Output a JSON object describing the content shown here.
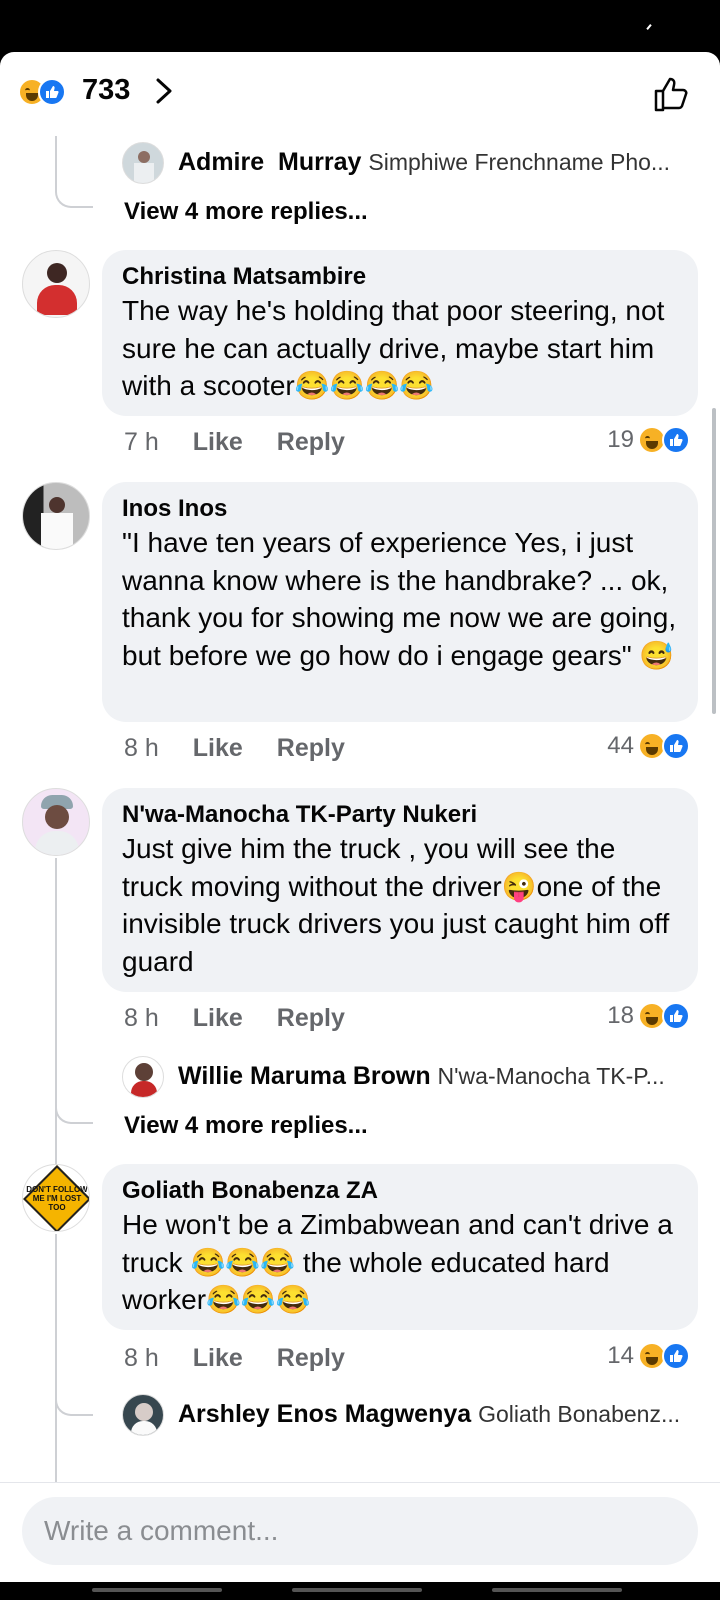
{
  "header": {
    "reaction_total": "733"
  },
  "comments": [
    {
      "author": "Christina Matsambire",
      "text": "The way he's holding that poor steering, not sure he can actually drive, maybe start him with a scooter",
      "emoji_suffix": "😂😂😂😂",
      "time": "7 h",
      "like": "Like",
      "reply": "Reply",
      "reactions": "19"
    },
    {
      "author": "Inos Inos",
      "text": "\"I have ten years of experience Yes, i just wanna know where is the handbrake? ... ok, thank you for showing me now we are going, but before we go how do i engage gears\"",
      "emoji_suffix": "😅",
      "time": "8 h",
      "like": "Like",
      "reply": "Reply",
      "reactions": "44"
    },
    {
      "author": "N'wa-Manocha TK-Party Nukeri",
      "text_a": "Just give him the truck , you will see the truck moving without the driver",
      "emoji_mid": "😜",
      "text_b": "one of the invisible truck drivers you just caught him off guard",
      "time": "8 h",
      "like": "Like",
      "reply": "Reply",
      "reactions": "18"
    },
    {
      "author": "Goliath Bonabenza ZA",
      "text_a": "He won't be a Zimbabwean and can't drive a truck",
      "emoji_mid": "😂😂😂",
      "text_b": "the whole educated hard worker",
      "emoji_suffix": "😂😂😂",
      "time": "8 h",
      "like": "Like",
      "reply": "Reply",
      "reactions": "14"
    }
  ],
  "replies": [
    {
      "author_first": "Admire",
      "author_last": "Murray",
      "preview": "Simphiwe Frenchname Pho..."
    },
    {
      "author": "Willie Maruma Brown",
      "preview": "N'wa-Manocha TK-P..."
    },
    {
      "author": "Arshley Enos Magwenya",
      "preview": "Goliath Bonabenz..."
    }
  ],
  "view_more": [
    "View 4 more replies...",
    "View 4 more replies..."
  ],
  "goliath_avatar_text": "DON'T FOLLOW ME I'M LOST TOO",
  "composer": {
    "placeholder": "Write a comment..."
  },
  "colors": {
    "accent": "#1877f2",
    "bubble": "#f0f2f5",
    "haha": "#f7b125"
  }
}
